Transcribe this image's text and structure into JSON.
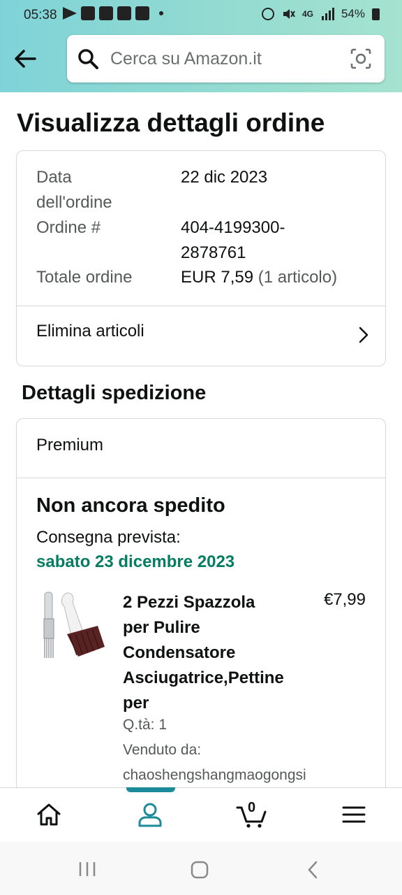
{
  "status_bar": {
    "time": "05:38",
    "network": "4G",
    "battery": "54%"
  },
  "search": {
    "placeholder": "Cerca su Amazon.it"
  },
  "page": {
    "title": "Visualizza dettagli ordine"
  },
  "order_summary": {
    "date_label_line1": "Data",
    "date_label_line2": "dell'ordine",
    "date_value": "22 dic 2023",
    "order_label": "Ordine #",
    "order_value_line1": "404-4199300-",
    "order_value_line2": "2878761",
    "total_label": "Totale ordine",
    "total_value": "EUR 7,59",
    "total_items": "(1 articolo)",
    "remove_items_label": "Elimina articoli"
  },
  "shipping": {
    "section_title": "Dettagli spedizione",
    "service": "Premium",
    "status": "Non ancora spedito",
    "delivery_label": "Consegna prevista:",
    "delivery_date": "sabato 23 dicembre 2023",
    "item": {
      "title_line1": "2 Pezzi Spazzola",
      "title_line2": "per Pulire",
      "title_line3": "Condensatore",
      "title_line4": "Asciugatrice,Pettine",
      "title_line5": "per",
      "price": "€7,99",
      "quantity": "Q.tà: 1",
      "sold_by_label": "Venduto da:",
      "seller": "chaoshengshangmaogongsi"
    }
  },
  "bottom_nav": {
    "cart_count": "0",
    "items": [
      "home-icon",
      "account-icon",
      "cart-icon",
      "menu-icon"
    ],
    "active_color": "#1d8a99"
  },
  "colors": {
    "accent_green": "#067d62",
    "header_gradient_start": "#7fd3d8",
    "header_gradient_end": "#a5e3cf"
  }
}
